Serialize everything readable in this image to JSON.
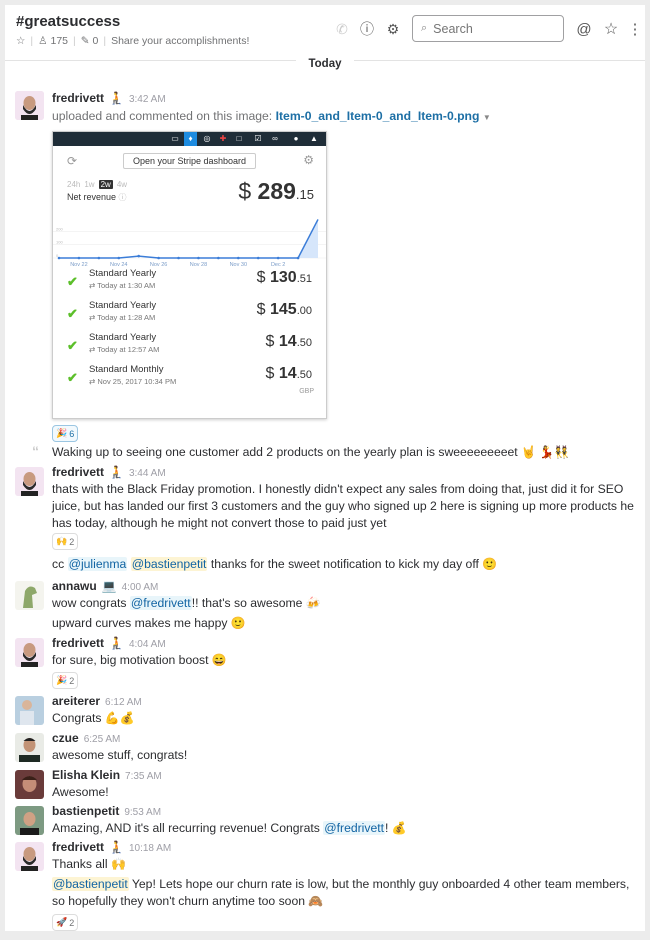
{
  "header": {
    "channel": "#greatsuccess",
    "members": "175",
    "pins": "0",
    "topic": "Share your accomplishments!",
    "search_placeholder": "Search",
    "day_divider": "Today"
  },
  "icons": {
    "star": "☆",
    "member": "👤",
    "pin": "📌",
    "phone": "✆",
    "info": "ⓘ",
    "gear": "⚙",
    "search": "🔍",
    "at": "@",
    "more": "⋮"
  },
  "messages": [
    {
      "user": "fredrivett",
      "status_emoji": "🧎",
      "time": "3:42 AM",
      "upload_prefix": "uploaded and commented on this image:",
      "file_name": "Item-0_and_Item-0_and_Item-0.png",
      "reaction": {
        "emoji": "🎉",
        "count": "6"
      },
      "comment": "Waking up to seeing one customer add 2 products on the yearly plan is sweeeeeeeeet",
      "comment_emojis": "🤘 💃👯"
    },
    {
      "user": "fredrivett",
      "status_emoji": "🧎",
      "time": "3:44 AM",
      "text": "thats with the Black Friday promotion. I honestly didn't expect any sales from doing that, just did it for SEO juice, but has landed our first 3 customers and the guy who signed up 2 here is signing up more products he has today, although he might not convert those to paid just yet",
      "reaction": {
        "emoji": "🙌",
        "count": "2"
      },
      "text2_prefix": "cc",
      "mention1": "@julienma",
      "mention2": "@bastienpetit",
      "text2_suffix": "thanks for the sweet notification to kick my day off",
      "text2_emoji": "🙂"
    },
    {
      "user": "annawu",
      "status_emoji": "💻",
      "time": "4:00 AM",
      "text_prefix": "wow congrats",
      "mention": "@fredrivett",
      "text_suffix": "!! that's so awesome",
      "emoji": "🍻",
      "text2": "upward curves makes me happy",
      "text2_emoji": "🙂"
    },
    {
      "user": "fredrivett",
      "status_emoji": "🧎",
      "time": "4:04 AM",
      "text": "for sure, big motivation boost",
      "emoji": "😄",
      "reaction": {
        "emoji": "🎉",
        "count": "2"
      }
    },
    {
      "user": "areiterer",
      "time": "6:12 AM",
      "text": "Congrats",
      "emoji": "💪💰"
    },
    {
      "user": "czue",
      "time": "6:25 AM",
      "text": "awesome stuff, congrats!"
    },
    {
      "user": "Elisha Klein",
      "time": "7:35 AM",
      "text": "Awesome!"
    },
    {
      "user": "bastienpetit",
      "time": "9:53 AM",
      "text_prefix": "Amazing, AND it's all recurring revenue! Congrats",
      "mention": "@fredrivett",
      "text_suffix": "!",
      "emoji": "💰"
    },
    {
      "user": "fredrivett",
      "status_emoji": "🧎",
      "time": "10:18 AM",
      "text": "Thanks all",
      "emoji": "🙌",
      "mention": "@bastienpetit",
      "text2": "Yep! Lets hope our churn rate is low, but the monthly guy onboarded 4 other team members, so hopefully they won't churn anytime too soon",
      "text2_emoji": "🙈",
      "reaction": {
        "emoji": "🚀",
        "count": "2"
      }
    }
  ],
  "stripe_widget": {
    "open_button": "Open your Stripe dashboard",
    "ranges": [
      "24h",
      "1w",
      "2w",
      "4w"
    ],
    "selected_range": "2w",
    "net_revenue_label": "Net revenue",
    "total_currency": "$",
    "total_whole": "289",
    "total_cents": ".15",
    "currency_note": "GBP",
    "transactions": [
      {
        "plan": "Standard Yearly",
        "when": "Today at 1:30 AM",
        "whole": "130",
        "cents": ".51"
      },
      {
        "plan": "Standard Yearly",
        "when": "Today at 1:28 AM",
        "whole": "145",
        "cents": ".00"
      },
      {
        "plan": "Standard Yearly",
        "when": "Today at 12:57 AM",
        "whole": "14",
        "cents": ".50"
      },
      {
        "plan": "Standard Monthly",
        "when": "Nov 25, 2017 10:34 PM",
        "whole": "14",
        "cents": ".50"
      }
    ],
    "accent": "#3b7dd8"
  },
  "chart_data": {
    "type": "area",
    "title": "Net revenue",
    "x": [
      "Nov 21",
      "Nov 22",
      "Nov 23",
      "Nov 24",
      "Nov 25",
      "Nov 26",
      "Nov 27",
      "Nov 28",
      "Nov 29",
      "Nov 30",
      "Dec 1",
      "Dec 2",
      "Dec 3",
      "Dec 4"
    ],
    "x_tick_labels": [
      "Nov 22",
      "Nov 24",
      "Nov 26",
      "Nov 28",
      "Nov 30",
      "Dec 2"
    ],
    "values": [
      0,
      0,
      0,
      0,
      14.5,
      0,
      0,
      0,
      0,
      0,
      0,
      0,
      0,
      289.15
    ],
    "y_ticks": [
      0,
      100,
      200
    ],
    "ylim": [
      0,
      300
    ],
    "grid": true
  }
}
